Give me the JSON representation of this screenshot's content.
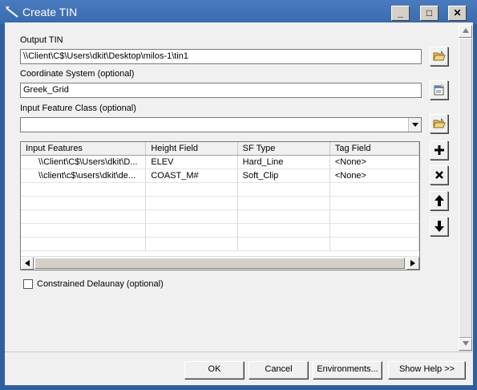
{
  "window": {
    "title": "Create TIN"
  },
  "titlebar_buttons": {
    "minimize": "_",
    "maximize": "□",
    "close": "✕"
  },
  "output_tin": {
    "label": "Output TIN",
    "value": "\\\\Client\\C$\\Users\\dkit\\Desktop\\milos-1\\tin1"
  },
  "coordinate_system": {
    "label": "Coordinate System (optional)",
    "value": "Greek_Grid"
  },
  "input_feature_class": {
    "label": "Input Feature Class (optional)",
    "value": ""
  },
  "table": {
    "columns": [
      "Input Features",
      "Height Field",
      "SF Type",
      "Tag Field"
    ],
    "rows": [
      [
        "\\\\Client\\C$\\Users\\dkit\\D...",
        "ELEV",
        "Hard_Line",
        "<None>"
      ],
      [
        "\\\\client\\c$\\users\\dkit\\de...",
        "COAST_M#",
        "Soft_Clip",
        "<None>"
      ]
    ]
  },
  "constrained_delaunay": {
    "label": "Constrained Delaunay (optional)",
    "checked": false
  },
  "footer": {
    "ok": "OK",
    "cancel": "Cancel",
    "environments": "Environments...",
    "show_help": "Show Help >>"
  },
  "icons": {
    "app": "tin-tool-icon",
    "browse": "open-folder-icon",
    "properties": "spatial-reference-properties-icon",
    "add": "plus-icon",
    "remove": "x-icon",
    "up": "arrow-up-icon",
    "down": "arrow-down-icon"
  }
}
